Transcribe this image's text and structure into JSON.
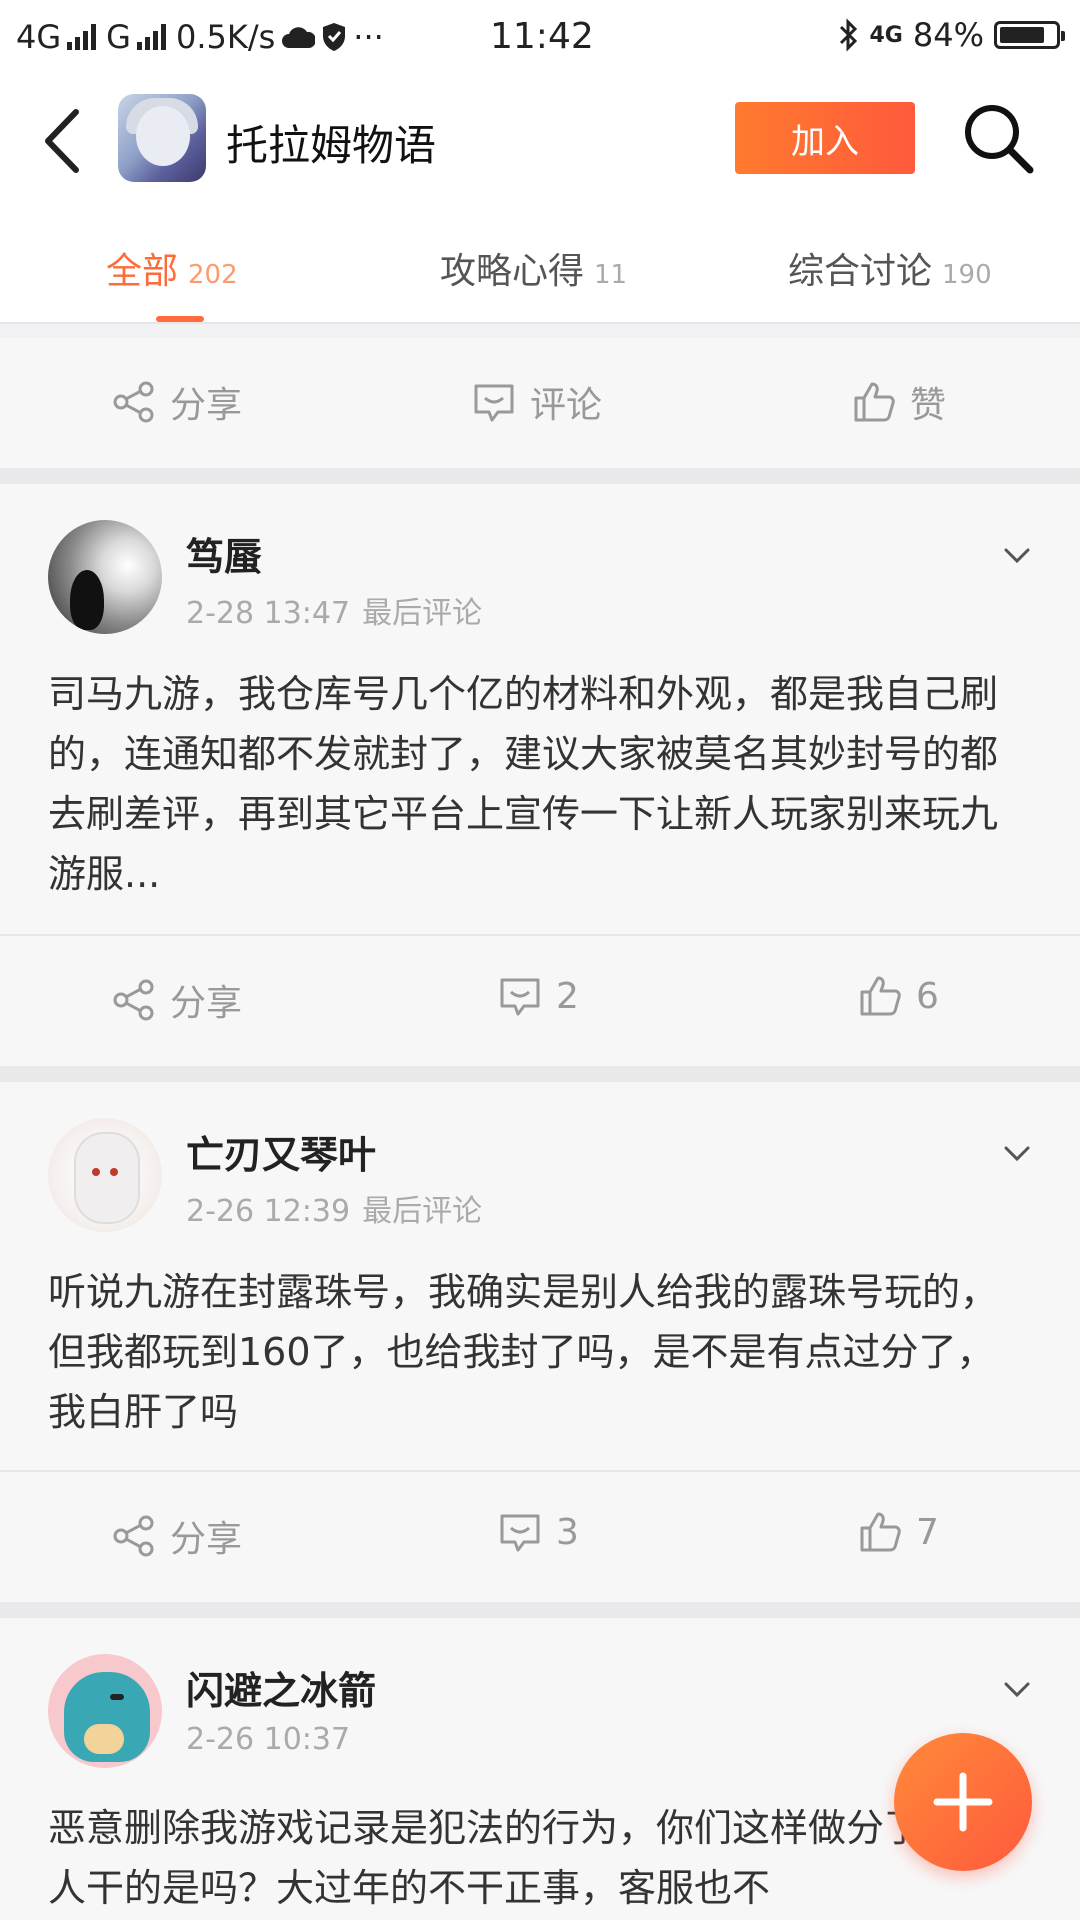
{
  "status_bar": {
    "net1": "4G",
    "net2": "G",
    "speed": "0.5K/s",
    "extra": "···",
    "time": "11:42",
    "right_net": "4G",
    "battery": "84%",
    "battery_level": 0.84
  },
  "header": {
    "title": "托拉姆物语",
    "join_label": "加入",
    "accent": "#ff6b3a"
  },
  "tabs": [
    {
      "label": "全部",
      "count": "202",
      "active": true
    },
    {
      "label": "攻略心得",
      "count": "11",
      "active": false
    },
    {
      "label": "综合讨论",
      "count": "190",
      "active": false
    }
  ],
  "top_actions": {
    "share": "分享",
    "comment": "评论",
    "like": "赞"
  },
  "posts": [
    {
      "username": "笃蜃",
      "time": "2-28 13:47",
      "last_comment": "最后评论",
      "body": "司马九游，我仓库号几个亿的材料和外观，都是我自己刷的，连通知都不发就封了，建议大家被莫名其妙封号的都去刷差评，再到其它平台上宣传一下让新人玩家别来玩九游服...",
      "share": "分享",
      "comments": "2",
      "likes": "6"
    },
    {
      "username": "亡刃又琴叶",
      "time": "2-26 12:39",
      "last_comment": "最后评论",
      "body": "听说九游在封露珠号，我确实是别人给我的露珠号玩的，但我都玩到160了，也给我封了吗，是不是有点过分了，我白肝了吗",
      "share": "分享",
      "comments": "3",
      "likes": "7"
    },
    {
      "username": "闪避之冰箭",
      "time": "2-26 10:37",
      "body": "恶意删除我游戏记录是犯法的行为，你们这样做分了。是人干的是吗？大过年的不干正事，客服也不"
    }
  ],
  "icons": {
    "back": "chevron-left-icon",
    "search": "search-icon",
    "share": "share-icon",
    "comment": "comment-icon",
    "like": "thumbs-up-icon",
    "more": "chevron-down-icon",
    "fab": "plus-icon"
  }
}
